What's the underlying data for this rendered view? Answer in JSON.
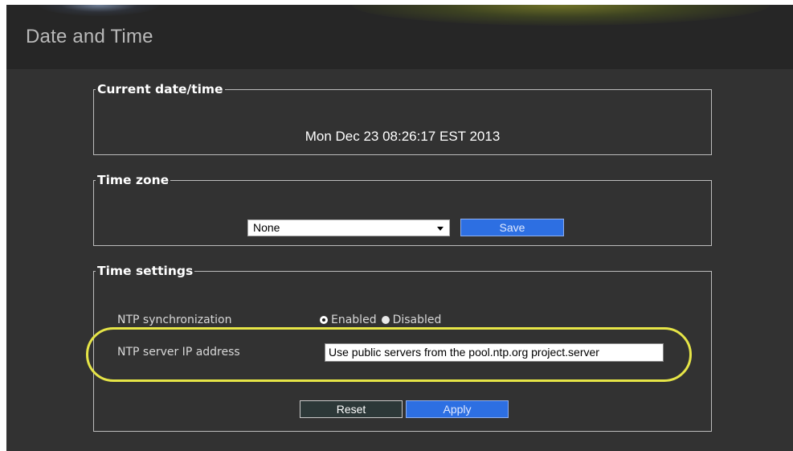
{
  "page": {
    "title": "Date and Time"
  },
  "current": {
    "legend": "Current date/time",
    "datetime": "Mon Dec 23 08:26:17 EST 2013"
  },
  "timezone": {
    "legend": "Time zone",
    "selected": "None",
    "save_label": "Save"
  },
  "time_settings": {
    "legend": "Time settings",
    "ntp_label": "NTP synchronization",
    "ntp_options": [
      "Enabled",
      "Disabled"
    ],
    "ntp_selected": "Enabled",
    "ip_label": "NTP server IP address",
    "ip_value": "Use public servers from the pool.ntp.org project.server",
    "reset_label": "Reset",
    "apply_label": "Apply"
  },
  "colors": {
    "panel_bg": "#323232",
    "header_bg": "#262626",
    "accent_blue": "#2d6fe2",
    "highlight": "#e6e547"
  },
  "icons": {
    "dropdown": "chevron-down-icon"
  }
}
